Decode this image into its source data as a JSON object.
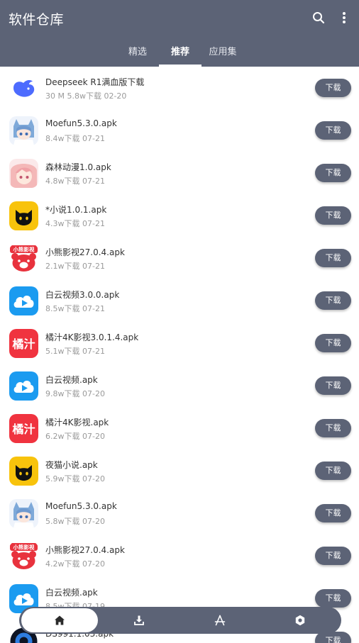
{
  "header": {
    "title": "软件仓库",
    "search_icon": "search-icon",
    "more_icon": "more-vertical-icon",
    "background": "#5c6376"
  },
  "tabs": [
    {
      "label": "精选",
      "active": false
    },
    {
      "label": "推荐",
      "active": true
    },
    {
      "label": "应用集",
      "active": false
    }
  ],
  "download_label": "下载",
  "apps": [
    {
      "icon": "deepseek-whale-icon",
      "name": "Deepseek R1满血版下载",
      "meta": "30 M  5.8w下载  02-20"
    },
    {
      "icon": "anime-girl-blue-icon",
      "name": "Moefun5.3.0.apk",
      "meta": "8.4w下载  07-21"
    },
    {
      "icon": "anime-girl-pink-icon",
      "name": "森林动漫1.0.apk",
      "meta": "4.8w下载  07-21"
    },
    {
      "icon": "black-cat-icon",
      "name": "*小说1.0.1.apk",
      "meta": "4.3w下载  07-21"
    },
    {
      "icon": "red-bear-icon",
      "name": "小熊影视27.0.4.apk",
      "meta": "2.1w下载  07-21"
    },
    {
      "icon": "cloud-play-icon",
      "name": "白云视频3.0.0.apk",
      "meta": "8.5w下载  07-21"
    },
    {
      "icon": "juzhi-icon",
      "name": "橘汁4K影视3.0.1.4.apk",
      "meta": "5.1w下载  07-21"
    },
    {
      "icon": "cloud-play-icon",
      "name": "白云视频.apk",
      "meta": "9.8w下载  07-20"
    },
    {
      "icon": "juzhi-icon",
      "name": "橘汁4K影视.apk",
      "meta": "6.2w下载  07-20"
    },
    {
      "icon": "black-cat-icon",
      "name": "夜猫小说.apk",
      "meta": "5.9w下载  07-20"
    },
    {
      "icon": "anime-girl-blue-icon",
      "name": "Moefun5.3.0.apk",
      "meta": "5.8w下载  07-20"
    },
    {
      "icon": "red-bear-icon",
      "name": "小熊影视27.0.4.apk",
      "meta": "4.2w下载  07-20"
    },
    {
      "icon": "cloud-play-icon",
      "name": "白云视频.apk",
      "meta": "8.5w下载  07-19"
    },
    {
      "icon": "camera-lens-icon",
      "name": "DS991.1.03.apk",
      "meta": ""
    }
  ],
  "icon_text": {
    "bear_label": "小熊影视",
    "juzhi_label": "橘汁"
  },
  "bottom_nav": [
    {
      "icon": "home-icon",
      "active": true
    },
    {
      "icon": "download-icon",
      "active": false
    },
    {
      "icon": "app-store-icon",
      "active": false
    },
    {
      "icon": "settings-icon",
      "active": false
    }
  ]
}
